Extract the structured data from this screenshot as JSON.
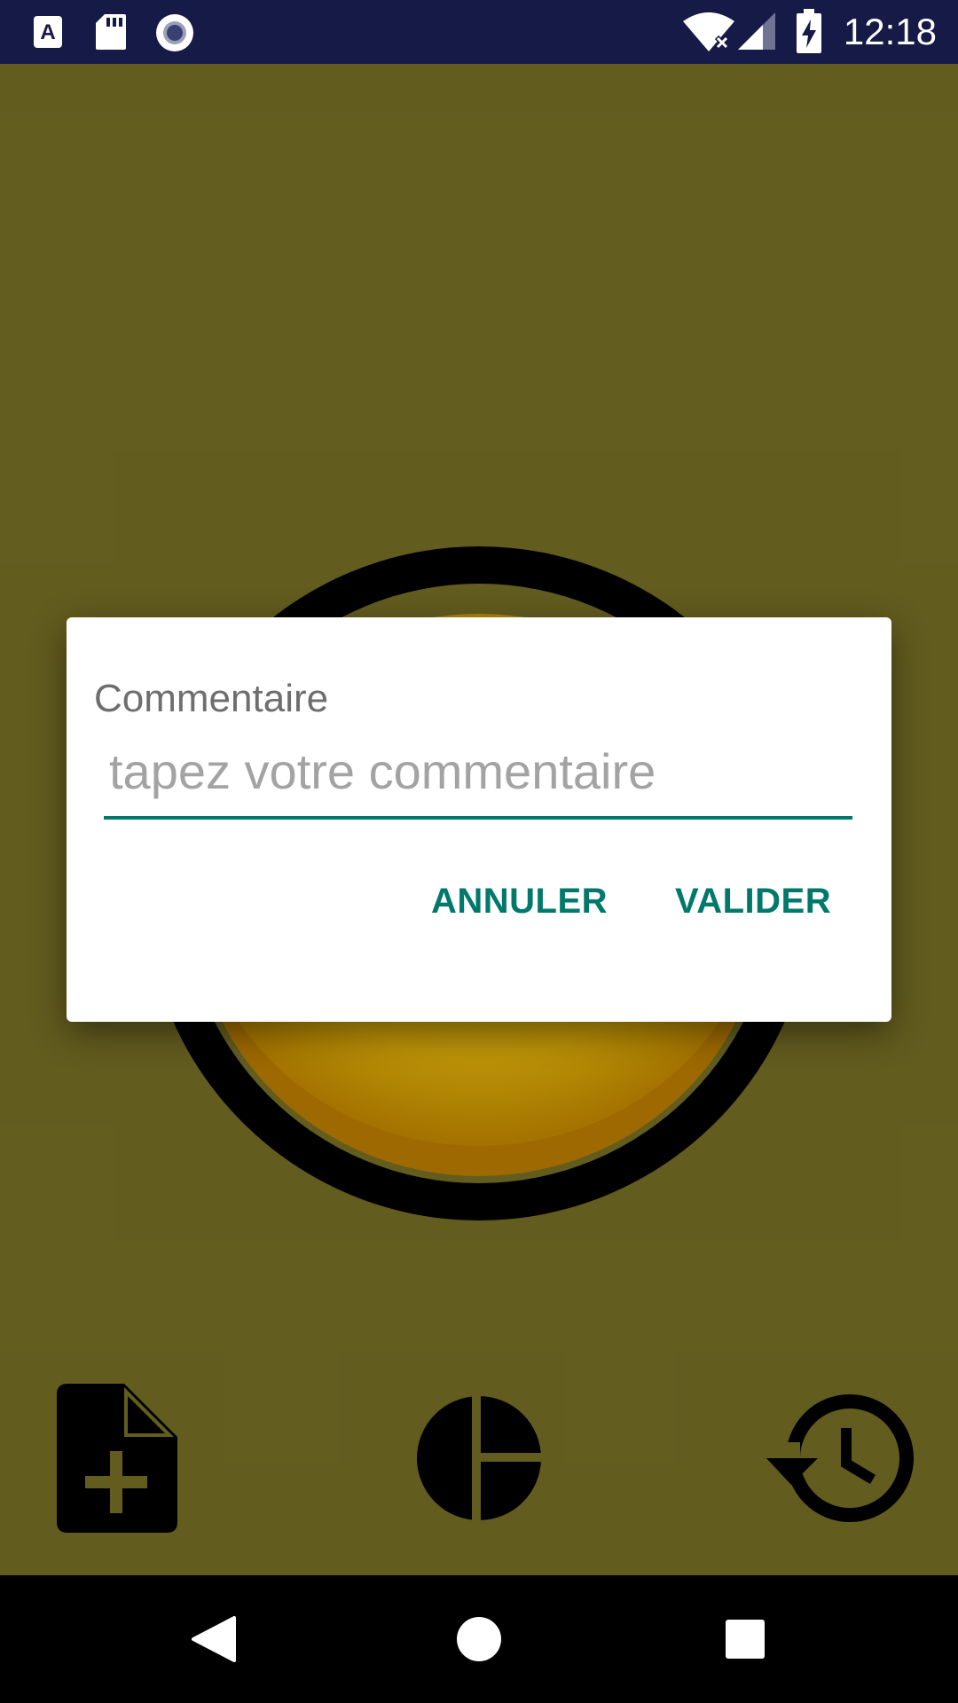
{
  "status_bar": {
    "time": "12:18",
    "icons": [
      "a-notification-icon",
      "sd-card-icon",
      "record-icon",
      "wifi-no-internet-icon",
      "cell-signal-icon",
      "battery-charging-icon"
    ],
    "background": "#151a46"
  },
  "app": {
    "background": "#837a2a",
    "main_button": "big-yellow-round-button",
    "bottom_actions": [
      "new-file-icon",
      "pie-chart-icon",
      "history-icon"
    ]
  },
  "dialog": {
    "title": "Commentaire",
    "input": {
      "value": "",
      "placeholder": "tapez votre commentaire"
    },
    "cancel_label": "ANNULER",
    "confirm_label": "VALIDER",
    "accent": "#00796b"
  },
  "nav_bar": {
    "buttons": [
      "back-icon",
      "home-icon",
      "recents-icon"
    ]
  }
}
